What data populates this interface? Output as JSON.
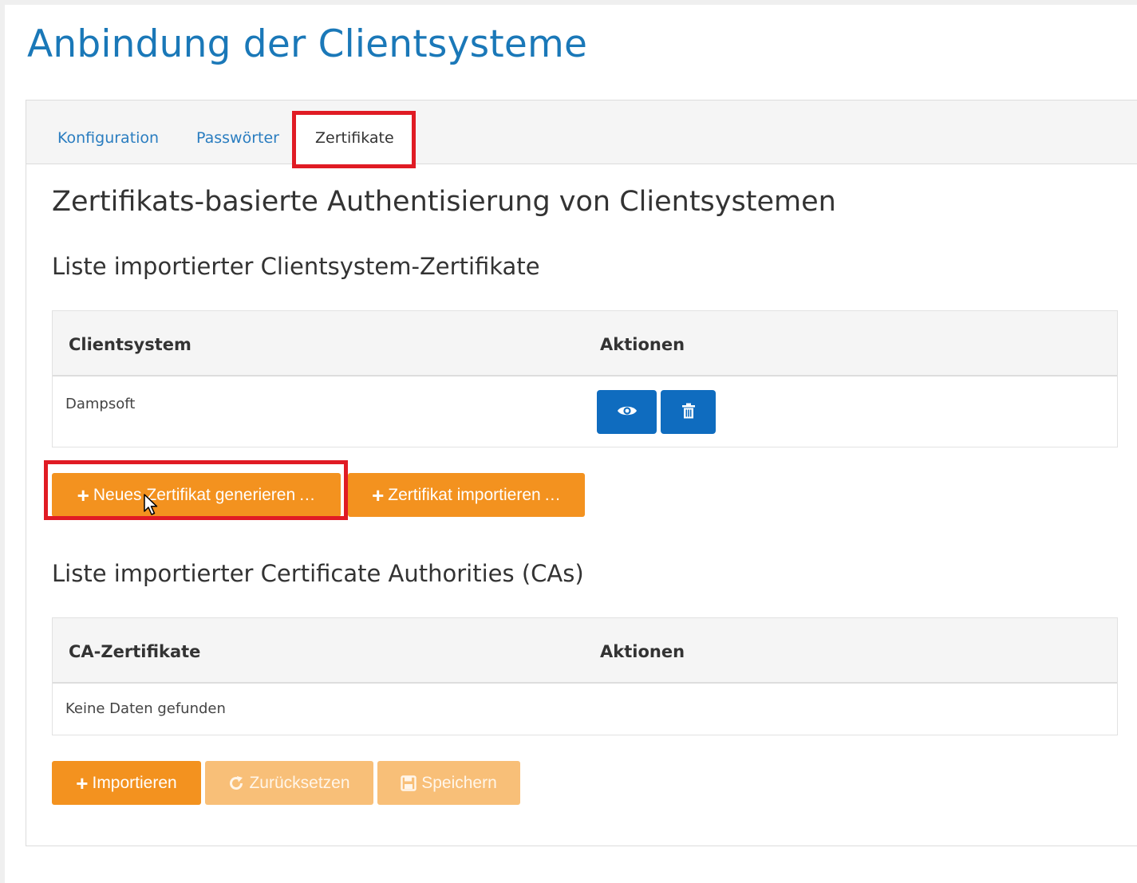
{
  "page": {
    "title": "Anbindung der Clientsysteme"
  },
  "tabs": [
    {
      "label": "Konfiguration",
      "active": false
    },
    {
      "label": "Passwörter",
      "active": false
    },
    {
      "label": "Zertifikate",
      "active": true
    }
  ],
  "section": {
    "title": "Zertifikats-basierte Authentisierung von Clientsystemen"
  },
  "clients": {
    "title": "Liste importierter Clientsystem-Zertifikate",
    "columns": [
      "Clientsystem",
      "Aktionen"
    ],
    "rows": [
      {
        "name": "Dampsoft",
        "actions": [
          "eye-icon",
          "trash-icon"
        ]
      }
    ],
    "buttons": {
      "generate": "Neues Zertifikat generieren …",
      "import": "Zertifikat importieren …"
    }
  },
  "cas": {
    "title": "Liste importierter Certificate Authorities (CAs)",
    "columns": [
      "CA-Zertifikate",
      "Aktionen"
    ],
    "empty_text": "Keine Daten gefunden",
    "buttons": {
      "import": "Importieren",
      "reset": "Zurücksetzen",
      "save": "Speichern"
    }
  },
  "colors": {
    "title_blue": "#1a78b8",
    "action_blue": "#0f6cbf",
    "orange": "#f3921f",
    "orange_disabled": "#f8bf78",
    "highlight_red": "#e01b24"
  }
}
